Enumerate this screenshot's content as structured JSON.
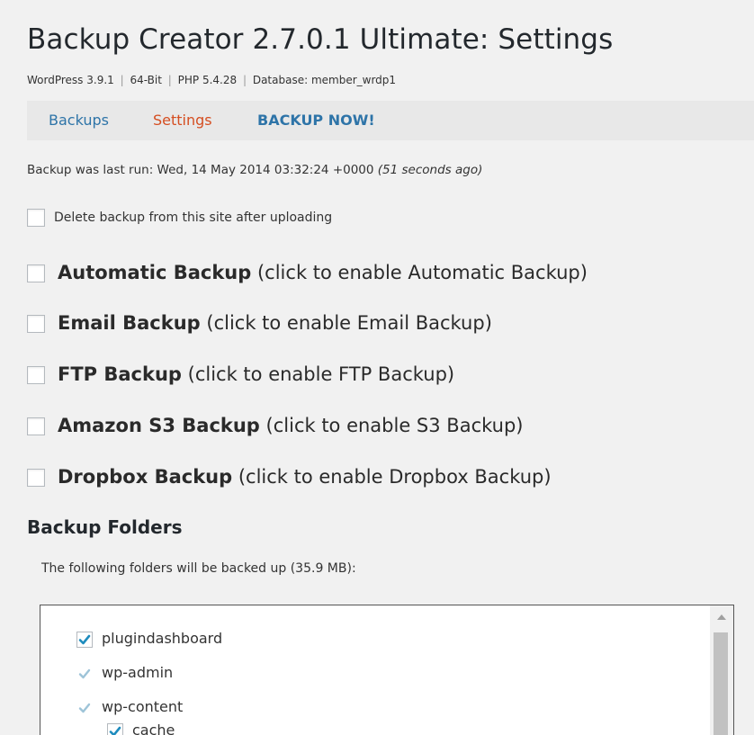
{
  "header": {
    "title": "Backup Creator 2.7.0.1 Ultimate: Settings",
    "wordpress": "WordPress 3.9.1",
    "arch": "64-Bit",
    "php": "PHP 5.4.28",
    "database": "Database: member_wrdp1",
    "separator": "|"
  },
  "nav": {
    "backups": "Backups",
    "settings": "Settings",
    "backup_now": "BACKUP NOW!"
  },
  "status": {
    "last_run": "Backup was last run: Wed, 14 May 2014 03:32:24 +0000",
    "ago": "(51 seconds ago)"
  },
  "delete_option": {
    "label": "Delete backup from this site after uploading",
    "checked": false
  },
  "options": [
    {
      "bold": "Automatic Backup",
      "rest": "(click to enable Automatic Backup)",
      "checked": false
    },
    {
      "bold": "Email Backup",
      "rest": "(click to enable Email Backup)",
      "checked": false
    },
    {
      "bold": "FTP Backup",
      "rest": "(click to enable FTP Backup)",
      "checked": false
    },
    {
      "bold": "Amazon S3 Backup",
      "rest": "(click to enable S3 Backup)",
      "checked": false
    },
    {
      "bold": "Dropbox Backup",
      "rest": "(click to enable Dropbox Backup)",
      "checked": false
    }
  ],
  "folders": {
    "heading": "Backup Folders",
    "note": "The following folders will be backed up (35.9 MB):",
    "items": [
      {
        "label": "plugindashboard",
        "checked": true,
        "disabled": false
      },
      {
        "label": "wp-admin",
        "checked": true,
        "disabled": true
      },
      {
        "label": "wp-content",
        "checked": true,
        "disabled": true
      },
      {
        "label": "cache",
        "checked": true,
        "disabled": false
      }
    ]
  },
  "colors": {
    "link": "#2e74a8",
    "active_tab": "#d54e21",
    "check_enabled": "#1e8cbe",
    "check_disabled": "#9ec4d8"
  }
}
